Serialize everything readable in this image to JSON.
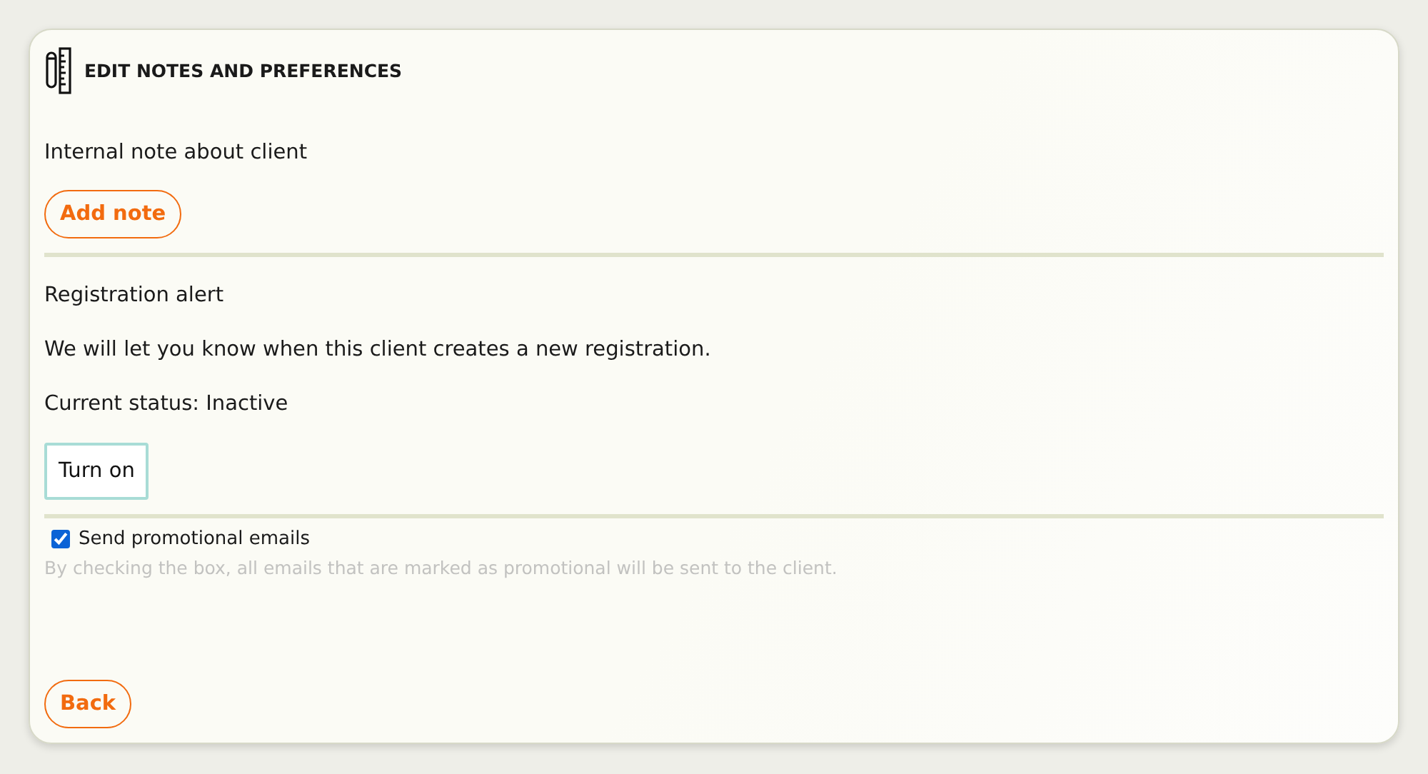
{
  "header": {
    "title": "EDIT NOTES AND PREFERENCES"
  },
  "note_section": {
    "label": "Internal note about client",
    "button": "Add note"
  },
  "registration_alert": {
    "title": "Registration alert",
    "description": "We will let you know when this client creates a new registration.",
    "status": "Current status: Inactive",
    "button": "Turn on"
  },
  "promotional": {
    "label": "Send promotional emails",
    "checked": true,
    "hint": "By checking the box, all emails that are marked as promotional will be sent to the client."
  },
  "footer": {
    "button": "Back"
  }
}
